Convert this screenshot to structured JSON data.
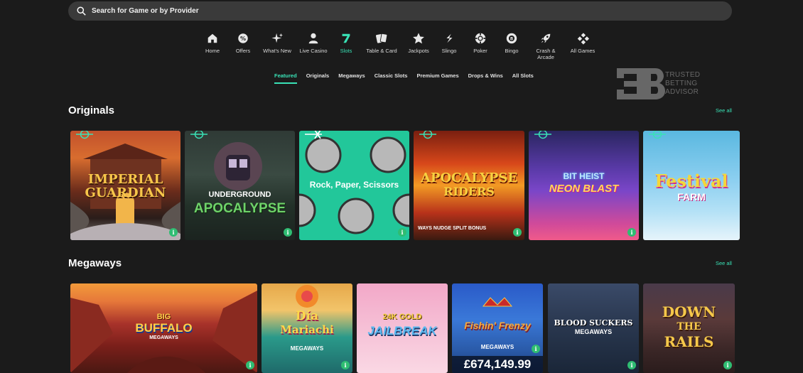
{
  "search": {
    "placeholder": "Search for Game or by Provider"
  },
  "categories": [
    {
      "label": "Home",
      "icon": "home-icon"
    },
    {
      "label": "Offers",
      "icon": "offers-icon"
    },
    {
      "label": "What's New",
      "icon": "sparkle-icon"
    },
    {
      "label": "Live Casino",
      "icon": "dealer-icon"
    },
    {
      "label": "Slots",
      "icon": "seven-icon"
    },
    {
      "label": "Table & Card",
      "icon": "cards-icon"
    },
    {
      "label": "Jackpots",
      "icon": "star-icon"
    },
    {
      "label": "Slingo",
      "icon": "slingo-icon"
    },
    {
      "label": "Poker",
      "icon": "chip-icon"
    },
    {
      "label": "Bingo",
      "icon": "bingo-ball-icon"
    },
    {
      "label": "Crash &\nArcade",
      "icon": "rocket-icon"
    },
    {
      "label": "All Games",
      "icon": "dice-icon"
    }
  ],
  "active_category": "Slots",
  "subtabs": [
    "Featured",
    "Originals",
    "Megaways",
    "Classic Slots",
    "Premium Games",
    "Drops & Wins",
    "All Slots"
  ],
  "active_subtab": "Featured",
  "logo": {
    "lines": [
      "TRUSTED",
      "BETTING",
      "ADVISOR"
    ]
  },
  "sections": {
    "originals": {
      "title": "Originals",
      "see_all": "See all",
      "games": [
        {
          "title": "IMPERIAL GUARDIAN"
        },
        {
          "title_top": "UNDERGROUND",
          "title_bottom": "APOCALYPSE"
        },
        {
          "title": "Rock, Paper, Scissors"
        },
        {
          "title_top": "APOCALYPSE",
          "title_bottom": "RIDERS",
          "sub": "WAYS  NUDGE  SPLIT  BONUS"
        },
        {
          "title_top": "BIT HEIST",
          "title_bottom": "NEON BLAST"
        },
        {
          "title_top": "Festival",
          "title_bottom": "FARM"
        }
      ]
    },
    "megaways": {
      "title": "Megaways",
      "see_all": "See all",
      "games": [
        {
          "title_top": "BIG",
          "title_bottom": "BUFFALO",
          "sub": "MEGAWAYS"
        },
        {
          "title_top": "Día",
          "title_bottom": "Mariachi",
          "sub": "MEGAWAYS"
        },
        {
          "title_top": "24K GOLD",
          "title_bottom": "JAILBREAK"
        },
        {
          "title_top": "Fishin' Frenzy",
          "sub": "MEGAWAYS",
          "jackpot": "£674,149.99"
        },
        {
          "title_top": "BLOOD SUCKERS",
          "sub": "MEGAWAYS"
        },
        {
          "title_top": "DOWN",
          "title_mid": "THE",
          "title_bottom": "RAILS"
        }
      ]
    }
  },
  "colors": {
    "accent": "#39e2b6",
    "background": "#1b1b1b",
    "search_bg": "#3a3a3a",
    "info_badge": "#2fbd72"
  }
}
